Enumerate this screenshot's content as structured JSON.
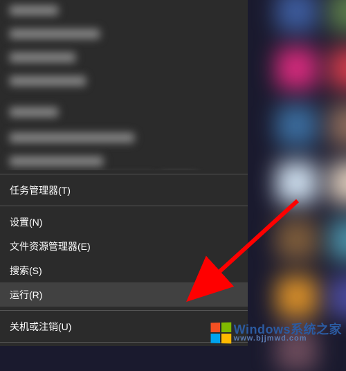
{
  "menu": {
    "task_manager": "任务管理器(T)",
    "settings": "设置(N)",
    "file_explorer": "文件资源管理器(E)",
    "search": "搜索(S)",
    "run": "运行(R)",
    "shutdown": "关机或注销(U)"
  },
  "highlighted_item": "run",
  "watermark": {
    "brand": "Windows系统之家",
    "url": "www.bjjmwd.com"
  },
  "colors": {
    "menu_bg": "#2b2b2b",
    "highlight": "#414141",
    "arrow": "#ff0000",
    "logo_tl": "#f25022",
    "logo_tr": "#7fba00",
    "logo_bl": "#00a4ef",
    "logo_br": "#ffb900"
  }
}
